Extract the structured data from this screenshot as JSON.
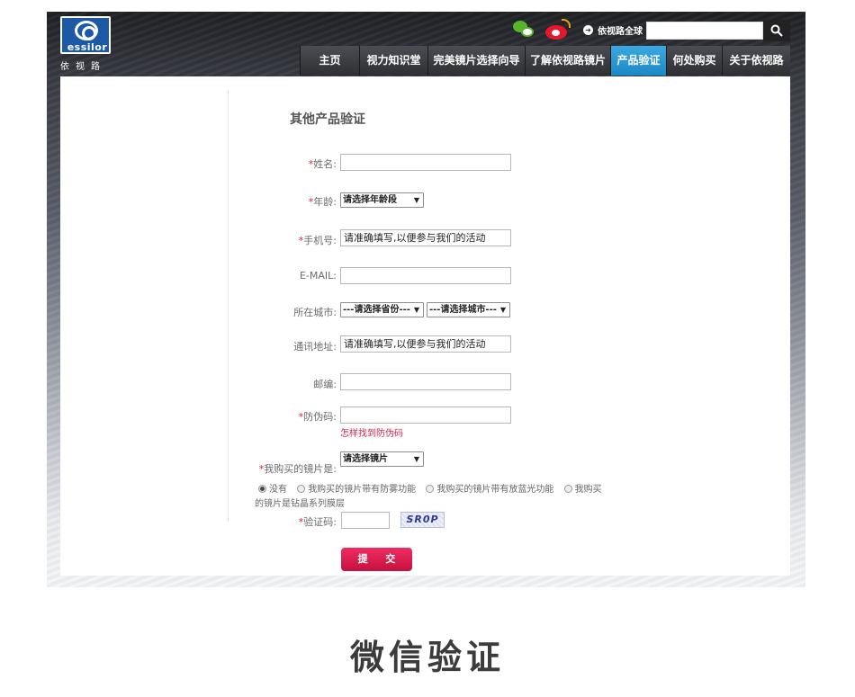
{
  "header": {
    "logo_brand": "essilor",
    "logo_cn": "依视路",
    "global_link": "依视路全球",
    "search": {
      "placeholder": "",
      "value": ""
    }
  },
  "nav": {
    "items": [
      {
        "label": "主页"
      },
      {
        "label": "视力知识堂"
      },
      {
        "label": "完美镜片选择向导"
      },
      {
        "label": "了解依视路镜片"
      },
      {
        "label": "产品验证",
        "active": true
      },
      {
        "label": "何处购买"
      },
      {
        "label": "关于依视路"
      }
    ]
  },
  "form": {
    "title": "其他产品验证",
    "required_mark": "*",
    "name_label": "姓名:",
    "age_label": "年龄:",
    "age_select": "请选择年龄段",
    "phone_label": "手机号:",
    "phone_value": "请准确填写,以便参与我们的活动",
    "email_label": "E-MAIL:",
    "city_label": "所在城市:",
    "province_select": "---请选择省份---",
    "city_select": "---请选择城市---",
    "address_label": "通讯地址:",
    "address_value": "请准确填写,以便参与我们的活动",
    "zip_label": "邮编:",
    "code_label": "防伪码:",
    "code_help_link": "怎样找到防伪码",
    "lens_label": "我购买的镜片是:",
    "lens_select": "请选择镜片",
    "radio_options": [
      "没有",
      "我购买的镜片带有防雾功能",
      "我购买的镜片带有放蓝光功能",
      "我购买"
    ],
    "radio_wrap_text": "的镜片是钻晶系列膜层",
    "captcha_label": "验证码:",
    "captcha_text": "SR0P",
    "submit_label": "提 交"
  },
  "footer_title": "微信验证",
  "colors": {
    "accent_blue": "#1d88c7",
    "required_red": "#e4183b",
    "submit_red": "#c4123f"
  }
}
